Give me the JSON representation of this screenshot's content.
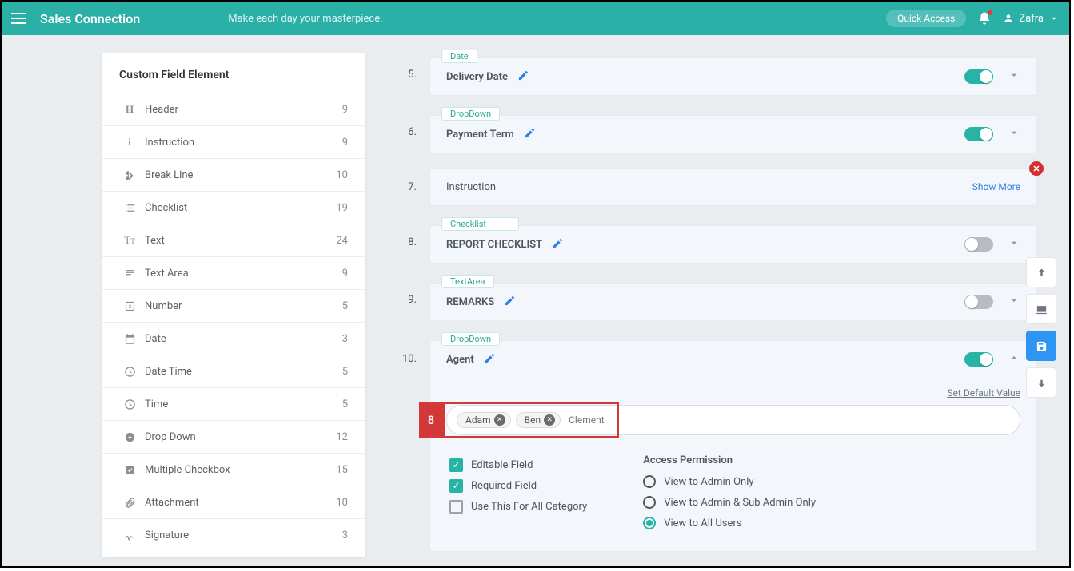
{
  "header": {
    "brand": "Sales Connection",
    "tagline": "Make each day your masterpiece.",
    "quick_access": "Quick Access",
    "user": "Zafra"
  },
  "panel": {
    "title": "Custom Field Element",
    "items": [
      {
        "icon": "H",
        "label": "Header",
        "count": 9
      },
      {
        "icon": "i",
        "label": "Instruction",
        "count": 9
      },
      {
        "icon": "scissors",
        "label": "Break Line",
        "count": 10
      },
      {
        "icon": "checklist",
        "label": "Checklist",
        "count": 19
      },
      {
        "icon": "text",
        "label": "Text",
        "count": 24
      },
      {
        "icon": "textarea",
        "label": "Text Area",
        "count": 9
      },
      {
        "icon": "number",
        "label": "Number",
        "count": 5
      },
      {
        "icon": "calendar",
        "label": "Date",
        "count": 3
      },
      {
        "icon": "clock",
        "label": "Date Time",
        "count": 5
      },
      {
        "icon": "clock",
        "label": "Time",
        "count": 5
      },
      {
        "icon": "dropdown",
        "label": "Drop Down",
        "count": 12
      },
      {
        "icon": "checkbox",
        "label": "Multiple Checkbox",
        "count": 15
      },
      {
        "icon": "attach",
        "label": "Attachment",
        "count": 10
      },
      {
        "icon": "signature",
        "label": "Signature",
        "count": 3
      }
    ]
  },
  "builder": {
    "rows": [
      {
        "num": "5.",
        "tag": "Date",
        "title": "Delivery Date",
        "toggle": true,
        "expanded": false
      },
      {
        "num": "6.",
        "tag": "DropDown",
        "title": "Payment Term",
        "toggle": true,
        "expanded": false
      },
      {
        "num": "7.",
        "title": "Instruction",
        "show_more": "Show More",
        "closable": true
      },
      {
        "num": "8.",
        "tag": "Checklist",
        "title": "REPORT CHECKLIST",
        "toggle": false,
        "expanded": false
      },
      {
        "num": "9.",
        "tag": "TextArea",
        "title": "REMARKS",
        "toggle": false,
        "expanded": false
      },
      {
        "num": "10.",
        "tag": "DropDown",
        "title": "Agent",
        "toggle": true,
        "expanded": true,
        "closable": true
      }
    ],
    "step_badge": "8",
    "default_link": "Set Default Value",
    "chips": [
      "Adam",
      "Ben"
    ],
    "typing": "Clement",
    "checkboxes": {
      "editable": {
        "label": "Editable Field",
        "checked": true
      },
      "required": {
        "label": "Required Field",
        "checked": true
      },
      "allcat": {
        "label": "Use This For All Category",
        "checked": false
      }
    },
    "access": {
      "title": "Access Permission",
      "options": [
        {
          "label": "View to Admin Only",
          "selected": false
        },
        {
          "label": "View to Admin & Sub Admin Only",
          "selected": false
        },
        {
          "label": "View to All Users",
          "selected": true
        }
      ]
    }
  }
}
